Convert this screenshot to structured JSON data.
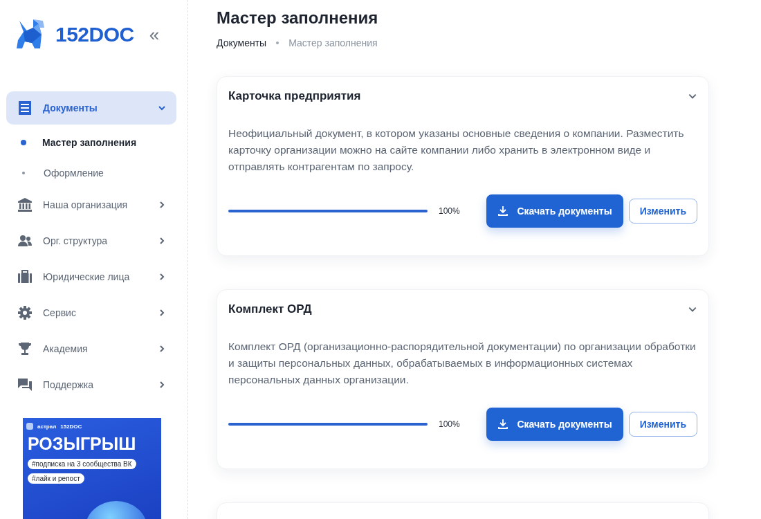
{
  "sidebar": {
    "logo": "152DOC",
    "collapse": "«",
    "nav": [
      {
        "label": "Документы",
        "kind": "document",
        "selected": true,
        "expanded": true,
        "children": [
          {
            "label": "Мастер заполнения",
            "selected": true
          },
          {
            "label": "Оформление",
            "selected": false
          }
        ]
      },
      {
        "label": "Наша организация",
        "kind": "bank",
        "selected": false,
        "expanded": false
      },
      {
        "label": "Орг. структура",
        "kind": "people",
        "selected": false,
        "expanded": false
      },
      {
        "label": "Юридические лица",
        "kind": "case",
        "selected": false,
        "expanded": false
      },
      {
        "label": "Сервис",
        "kind": "gear",
        "selected": false,
        "expanded": false
      },
      {
        "label": "Академия",
        "kind": "trophy",
        "selected": false,
        "expanded": false
      },
      {
        "label": "Поддержка",
        "kind": "chat",
        "selected": false,
        "expanded": false
      }
    ],
    "banner": {
      "brands": [
        "астрал",
        "152DOC"
      ],
      "headline": "РОЗЫГРЫШ",
      "tags": [
        "#подписка на 3 сообщества ВК",
        "#лайк и репост"
      ]
    }
  },
  "page": {
    "title": "Мастер заполнения",
    "breadcrumbs": [
      "Документы",
      "Мастер заполнения"
    ]
  },
  "cards": [
    {
      "title": "Карточка предприятия",
      "expanded": true,
      "description": "Неофициальный документ, в котором указаны основные сведения о компании. Разместить карточку организации можно на сайте компании либо хранить в электронном виде и отправлять контрагентам по запросу.",
      "level": 1,
      "percent": "100%",
      "download": "Скачать документы",
      "edit": "Изменить"
    },
    {
      "title": "Комплект ОРД",
      "expanded": true,
      "description": "Комплект ОРД (организационно-распорядительной документации) по организации обработки и защиты персональных данных, обрабатываемых в информационных системах персональных данных организации.",
      "level": 1,
      "percent": "100%",
      "download": "Скачать документы",
      "edit": "Изменить"
    }
  ]
}
